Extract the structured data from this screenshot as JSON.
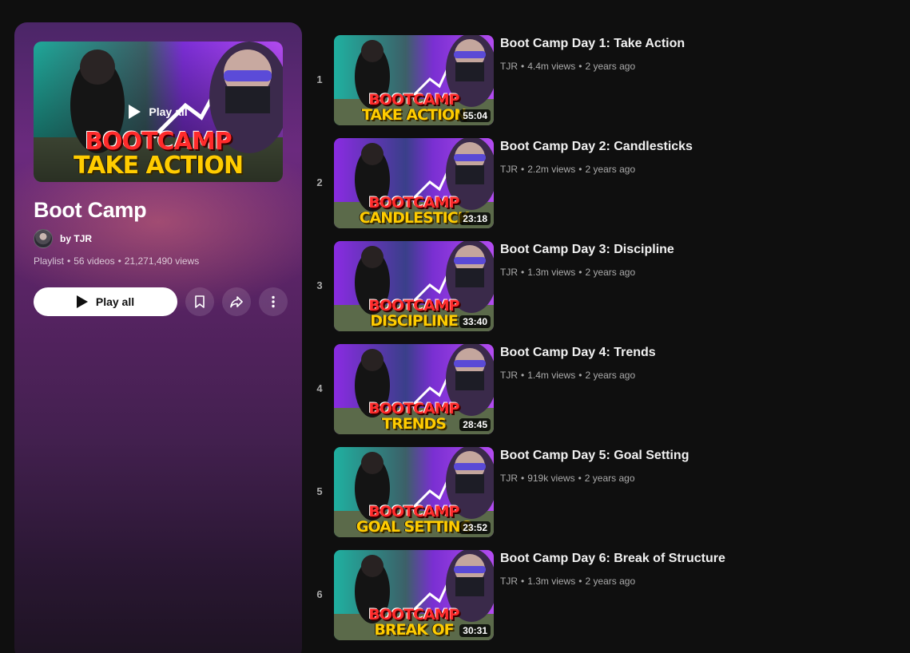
{
  "playlist": {
    "title": "Boot Camp",
    "owner_prefix": "by",
    "owner": "TJR",
    "type": "Playlist",
    "video_count": "56 videos",
    "total_views": "21,271,490 views",
    "thumbnail": {
      "overlay_label": "Play all",
      "banner_top": "BOOTCAMP",
      "banner_bottom": "TAKE ACTION"
    },
    "play_all_label": "Play all",
    "icons": {
      "save": "bookmark-icon",
      "share": "share-icon",
      "more": "more-vert-icon"
    },
    "colors": {
      "panel_top": "#6b2a7e",
      "panel_bottom": "#1d1322",
      "play_button_bg": "#ffffff"
    }
  },
  "videos": [
    {
      "index": "1",
      "title": "Boot Camp Day 1: Take Action",
      "channel": "TJR",
      "views": "4.4m views",
      "age": "2 years ago",
      "duration": "55:04",
      "banner_top": "BOOTCAMP",
      "banner_bottom": "TAKE ACTION",
      "palette": "cyan"
    },
    {
      "index": "2",
      "title": "Boot Camp Day 2: Candlesticks",
      "channel": "TJR",
      "views": "2.2m views",
      "age": "2 years ago",
      "duration": "23:18",
      "banner_top": "BOOTCAMP",
      "banner_bottom": "CANDLESTICK",
      "palette": "purple"
    },
    {
      "index": "3",
      "title": "Boot Camp Day 3: Discipline",
      "channel": "TJR",
      "views": "1.3m views",
      "age": "2 years ago",
      "duration": "33:40",
      "banner_top": "BOOTCAMP",
      "banner_bottom": "DISCIPLINE",
      "palette": "purple"
    },
    {
      "index": "4",
      "title": "Boot Camp Day 4: Trends",
      "channel": "TJR",
      "views": "1.4m views",
      "age": "2 years ago",
      "duration": "28:45",
      "banner_top": "BOOTCAMP",
      "banner_bottom": "TRENDS",
      "palette": "purple"
    },
    {
      "index": "5",
      "title": "Boot Camp Day 5: Goal Setting",
      "channel": "TJR",
      "views": "919k views",
      "age": "2 years ago",
      "duration": "23:52",
      "banner_top": "BOOTCAMP",
      "banner_bottom": "GOAL SETTING",
      "palette": "cyan"
    },
    {
      "index": "6",
      "title": "Boot Camp Day 6: Break of Structure",
      "channel": "TJR",
      "views": "1.3m views",
      "age": "2 years ago",
      "duration": "30:31",
      "banner_top": "BOOTCAMP",
      "banner_bottom": "BREAK OF STRUCTUR",
      "palette": "cyan"
    }
  ],
  "separator": "•"
}
